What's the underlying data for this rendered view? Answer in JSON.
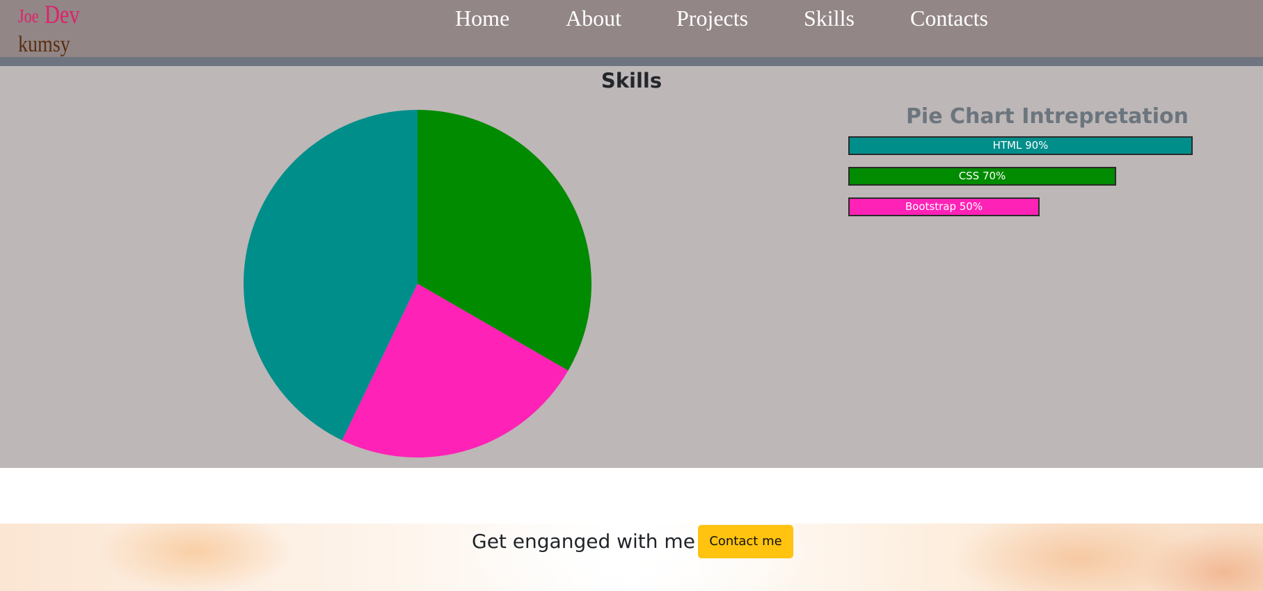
{
  "brand": {
    "first": "Joe",
    "second": "Dev",
    "tagline": "kumsy"
  },
  "nav": {
    "items": [
      {
        "label": "Home"
      },
      {
        "label": "About"
      },
      {
        "label": "Projects"
      },
      {
        "label": "Skills"
      },
      {
        "label": "Contacts"
      }
    ]
  },
  "skills": {
    "title": "Skills",
    "interpretation_title": "Pie Chart Intrepretation",
    "bars": [
      {
        "label": "HTML 90%",
        "percent": 90,
        "color": "#008e8b"
      },
      {
        "label": "CSS 70%",
        "percent": 70,
        "color": "#008b00"
      },
      {
        "label": "Bootstrap 50%",
        "percent": 50,
        "color": "#ff22b6"
      }
    ]
  },
  "chart_data": {
    "type": "pie",
    "categories": [
      "HTML",
      "CSS",
      "Bootstrap"
    ],
    "values": [
      90,
      70,
      50
    ],
    "colors": [
      "#008e8b",
      "#008b00",
      "#ff22b6"
    ],
    "start": "top",
    "direction": "clockwise",
    "order": [
      "CSS",
      "Bootstrap",
      "HTML"
    ],
    "title": ""
  },
  "footer": {
    "text": "Get enganged with me!",
    "button_label": "Contact me",
    "button_color": "#ffc310"
  }
}
